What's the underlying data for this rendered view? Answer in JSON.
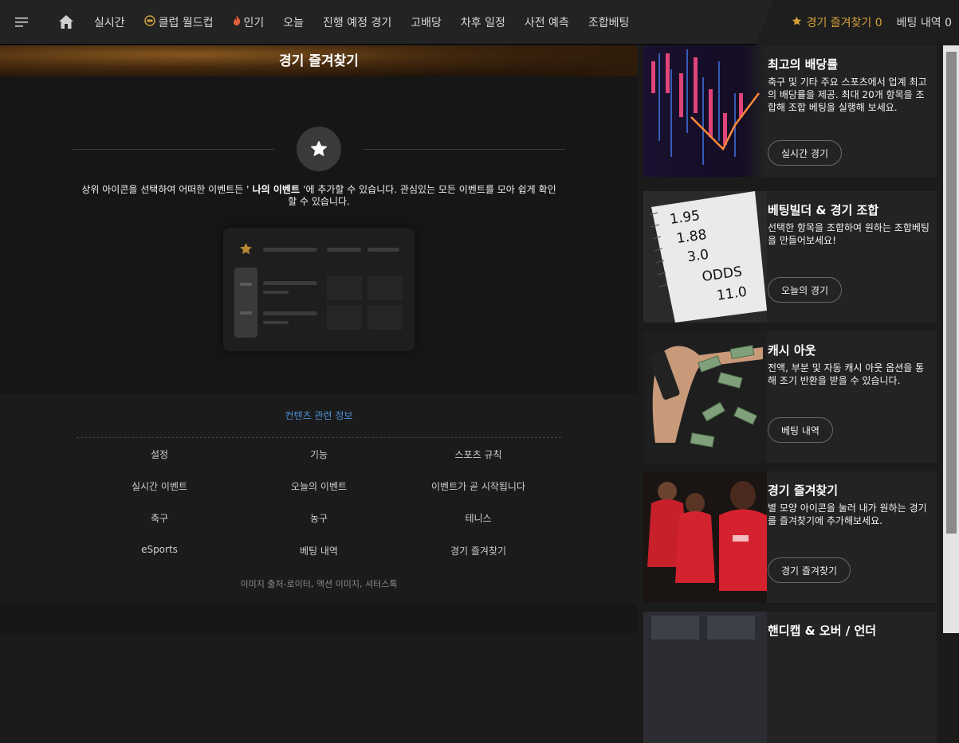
{
  "nav": {
    "live": "실시간",
    "club_world_cup": "클럽 월드컵",
    "popular": "인기",
    "today": "오늘",
    "upcoming": "진행 예정 경기",
    "high_odds": "고배당",
    "later": "차후 일정",
    "pre_match": "사전 예측",
    "combo": "조합베팅",
    "favorites": "경기 즐겨찾기 0",
    "bet_history": "베팅 내역 0"
  },
  "main": {
    "banner_title": "경기 즐겨찾기",
    "desc_part1": "상위 아이콘을 선택하여 어떠한 이벤트든 '",
    "desc_bold": " 나의 이벤트 ",
    "desc_part2": "'에 추가할 수 있습니다. 관심있는 모든 이벤트를 모아 쉽게 확인할 수 있습니다."
  },
  "footer": {
    "title": "컨텐츠 관련 정보",
    "links": [
      [
        "설정",
        "기능",
        "스포츠 규칙"
      ],
      [
        "실시간 이벤트",
        "오늘의 이벤트",
        "이벤트가 곧 시작됩니다"
      ],
      [
        "축구",
        "농구",
        "테니스"
      ],
      [
        "eSports",
        "베팅 내역",
        "경기 즐겨찾기"
      ]
    ],
    "credit": "이미지 출처-로이터, 액션 이미지, 셔터스톡"
  },
  "sidebar": {
    "cards": [
      {
        "title": "최고의 배당률",
        "text": "축구 및 기타 주요 스포츠에서 업계 최고의 배당률을 제공. 최대 20개 항목을 조합해 조합 베팅을 실행해 보세요.",
        "button": "실시간 경기"
      },
      {
        "title": "베팅빌더 & 경기 조합",
        "text": "선택한 항목을 조합하여 원하는 조합베팅을 만들어보세요!",
        "button": "오늘의 경기"
      },
      {
        "title": "캐시 아웃",
        "text": "전액, 부분 및 자동 캐시 아웃 옵션을 통해 조기 반환을 받을 수 있습니다.",
        "button": "베팅 내역"
      },
      {
        "title": "경기 즐겨찾기",
        "text": "별 모양 아이콘을 눌러 내가 원하는 경기를 즐겨찾기에 추가해보세요.",
        "button": "경기 즐겨찾기"
      },
      {
        "title": "핸디캡 & 오버 / 언더"
      }
    ],
    "notebook_odds": [
      "1.95",
      "1.88",
      "3.0",
      "ODDS",
      "11.0"
    ]
  },
  "colors": {
    "accent": "#d8a13b",
    "link": "#4d8fd6"
  }
}
